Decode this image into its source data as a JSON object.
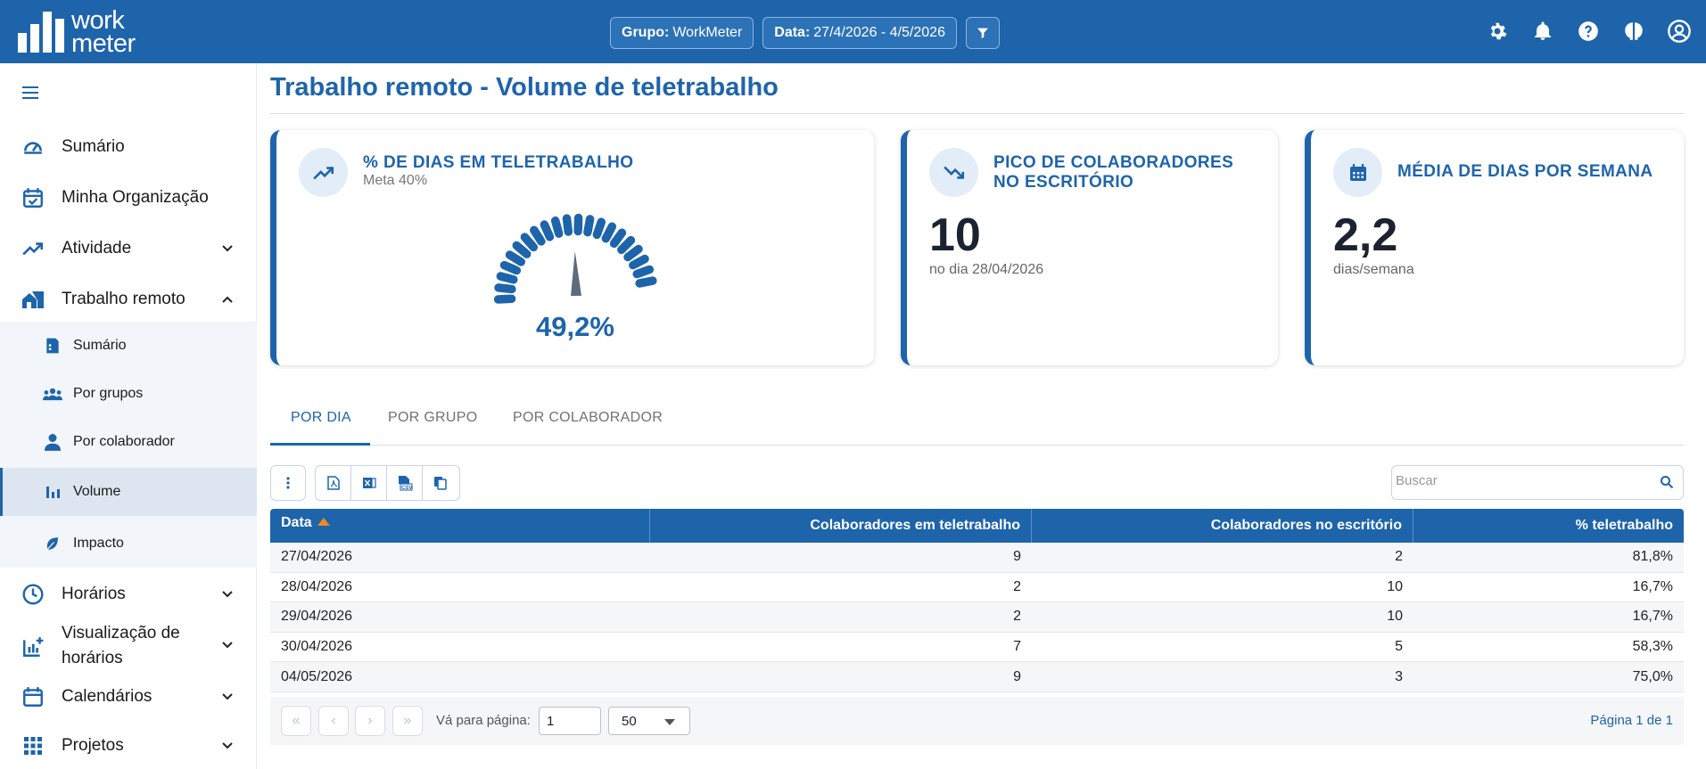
{
  "app": {
    "logo_line1": "work",
    "logo_line2": "meter"
  },
  "header": {
    "group_label": "Grupo:",
    "group_value": "WorkMeter",
    "date_label": "Data:",
    "date_value": "27/4/2026 - 4/5/2026",
    "icons": [
      "settings-icon",
      "bell-icon",
      "help-icon",
      "brain-icon",
      "account-icon"
    ]
  },
  "sidebar": {
    "items": [
      {
        "label": "Sumário",
        "icon": "gauge-icon"
      },
      {
        "label": "Minha Organização",
        "icon": "calendar-check-icon"
      },
      {
        "label": "Atividade",
        "icon": "trending-up-icon"
      },
      {
        "label": "Trabalho remoto",
        "icon": "home-work-icon"
      },
      {
        "label": "Horários",
        "icon": "clock-icon"
      },
      {
        "label": "Visualização de",
        "label2": "horários",
        "icon": "chart-add-icon"
      },
      {
        "label": "Calendários",
        "icon": "calendar-icon"
      },
      {
        "label": "Projetos",
        "icon": "apps-icon"
      }
    ],
    "subitems": [
      {
        "label": "Sumário",
        "icon": "summary-icon"
      },
      {
        "label": "Por grupos",
        "icon": "groups-icon"
      },
      {
        "label": "Por colaborador",
        "icon": "person-icon"
      },
      {
        "label": "Volume",
        "icon": "bar-chart-icon",
        "active": true
      },
      {
        "label": "Impacto",
        "icon": "leaf-icon"
      }
    ]
  },
  "page": {
    "title": "Trabalho remoto - Volume de teletrabalho"
  },
  "cards": {
    "telework": {
      "title": "% DE DIAS EM TELETRABALHO",
      "subtitle": "Meta 40%",
      "value": "49,2%",
      "gauge_fraction": 0.492
    },
    "peak": {
      "title_line1": "PICO DE COLABORADORES",
      "title_line2": "NO ESCRITÓRIO",
      "value": "10",
      "caption": "no dia 28/04/2026"
    },
    "average": {
      "title": "MÉDIA DE DIAS POR SEMANA",
      "value": "2,2",
      "caption": "dias/semana"
    }
  },
  "tabs": [
    "POR DIA",
    "POR GRUPO",
    "POR COLABORADOR"
  ],
  "search": {
    "placeholder": "Buscar",
    "value": ""
  },
  "table": {
    "headers": [
      "Data",
      "Colaboradores em teletrabalho",
      "Colaboradores no escritório",
      "% teletrabalho"
    ],
    "rows": [
      [
        "27/04/2026",
        "9",
        "2",
        "81,8%"
      ],
      [
        "28/04/2026",
        "2",
        "10",
        "16,7%"
      ],
      [
        "29/04/2026",
        "2",
        "10",
        "16,7%"
      ],
      [
        "30/04/2026",
        "7",
        "5",
        "58,3%"
      ],
      [
        "04/05/2026",
        "9",
        "3",
        "75,0%"
      ]
    ]
  },
  "pager": {
    "goto_label": "Vá para página:",
    "page_input": "1",
    "page_size": "50",
    "info": "Página 1 de 1"
  },
  "colors": {
    "primary": "#1e64ab",
    "accent": "#f08a24"
  }
}
